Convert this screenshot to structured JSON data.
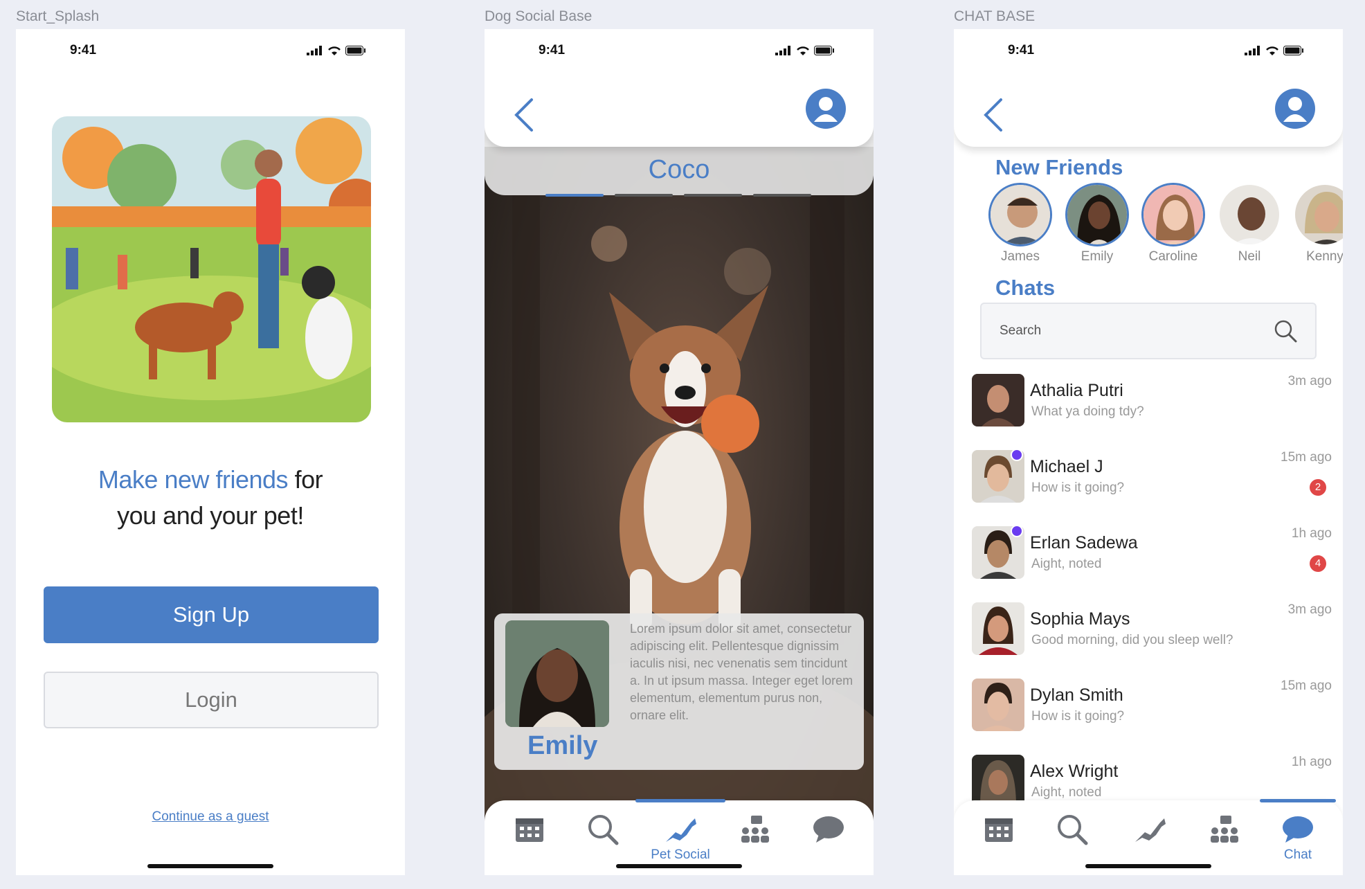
{
  "frames": {
    "splash": "Start_Splash",
    "social": "Dog Social Base",
    "chat": "CHAT BASE"
  },
  "status": {
    "time": "9:41"
  },
  "splash": {
    "headline_accent": "Make new friends",
    "headline_rest_1": " for",
    "headline_line2": "you and your pet!",
    "signup": "Sign Up",
    "login": "Login",
    "guest": "Continue as a guest"
  },
  "social": {
    "pet_name": "Coco",
    "owner_name": "Emily",
    "bio": "Lorem ipsum dolor sit amet, consectetur adipiscing elit. Pellentesque dignissim iaculis nisi, nec venenatis sem tincidunt a. In ut ipsum massa. Integer eget lorem elementum, elementum purus non, ornare elit.",
    "active_tab_label": "Pet Social"
  },
  "chat": {
    "new_friends_title": "New Friends",
    "friends": [
      {
        "name": "James"
      },
      {
        "name": "Emily"
      },
      {
        "name": "Caroline"
      },
      {
        "name": "Neil"
      },
      {
        "name": "Kenny"
      }
    ],
    "chats_title": "Chats",
    "search_placeholder": "Search",
    "rows": [
      {
        "name": "Athalia Putri",
        "message": "What ya doing tdy?",
        "time": "3m ago",
        "badge": ""
      },
      {
        "name": "Michael J",
        "message": "How is it going?",
        "time": "15m ago",
        "badge": "2"
      },
      {
        "name": "Erlan Sadewa",
        "message": "Aight, noted",
        "time": "1h ago",
        "badge": "4"
      },
      {
        "name": "Sophia Mays",
        "message": "Good morning, did you sleep well?",
        "time": "3m ago",
        "badge": ""
      },
      {
        "name": "Dylan Smith",
        "message": "How is it going?",
        "time": "15m ago",
        "badge": ""
      },
      {
        "name": "Alex Wright",
        "message": "Aight, noted",
        "time": "1h ago",
        "badge": ""
      }
    ],
    "active_tab_label": "Chat"
  },
  "colors": {
    "accent": "#4a7ec6",
    "badge": "#e04747",
    "online": "#6a3cf0"
  }
}
